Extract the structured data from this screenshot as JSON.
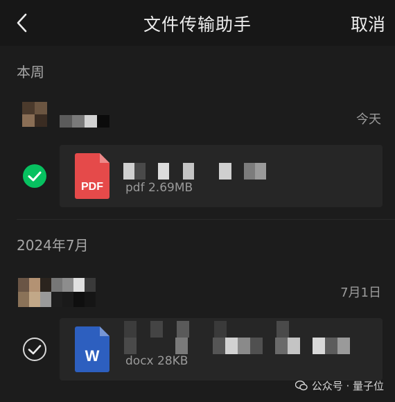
{
  "header": {
    "title": "文件传输助手",
    "cancel_label": "取消"
  },
  "sections": [
    {
      "label": "本周",
      "message": {
        "date": "今天",
        "selected": true,
        "file": {
          "type": "PDF",
          "meta": "pdf 2.69MB"
        }
      }
    },
    {
      "label": "2024年7月",
      "message": {
        "date": "7月1日",
        "selected": false,
        "file": {
          "type": "W",
          "meta": "docx 28KB"
        }
      }
    }
  ],
  "watermark": {
    "text": "公众号 · 量子位"
  },
  "colors": {
    "background": "#1c1c1c",
    "selected_check": "#07c160",
    "pdf_icon": "#e54a4a",
    "word_icon": "#2d5fbf"
  },
  "icons": [
    "back-chevron-icon",
    "check-icon",
    "pdf-file-icon",
    "word-file-icon",
    "wechat-icon"
  ]
}
